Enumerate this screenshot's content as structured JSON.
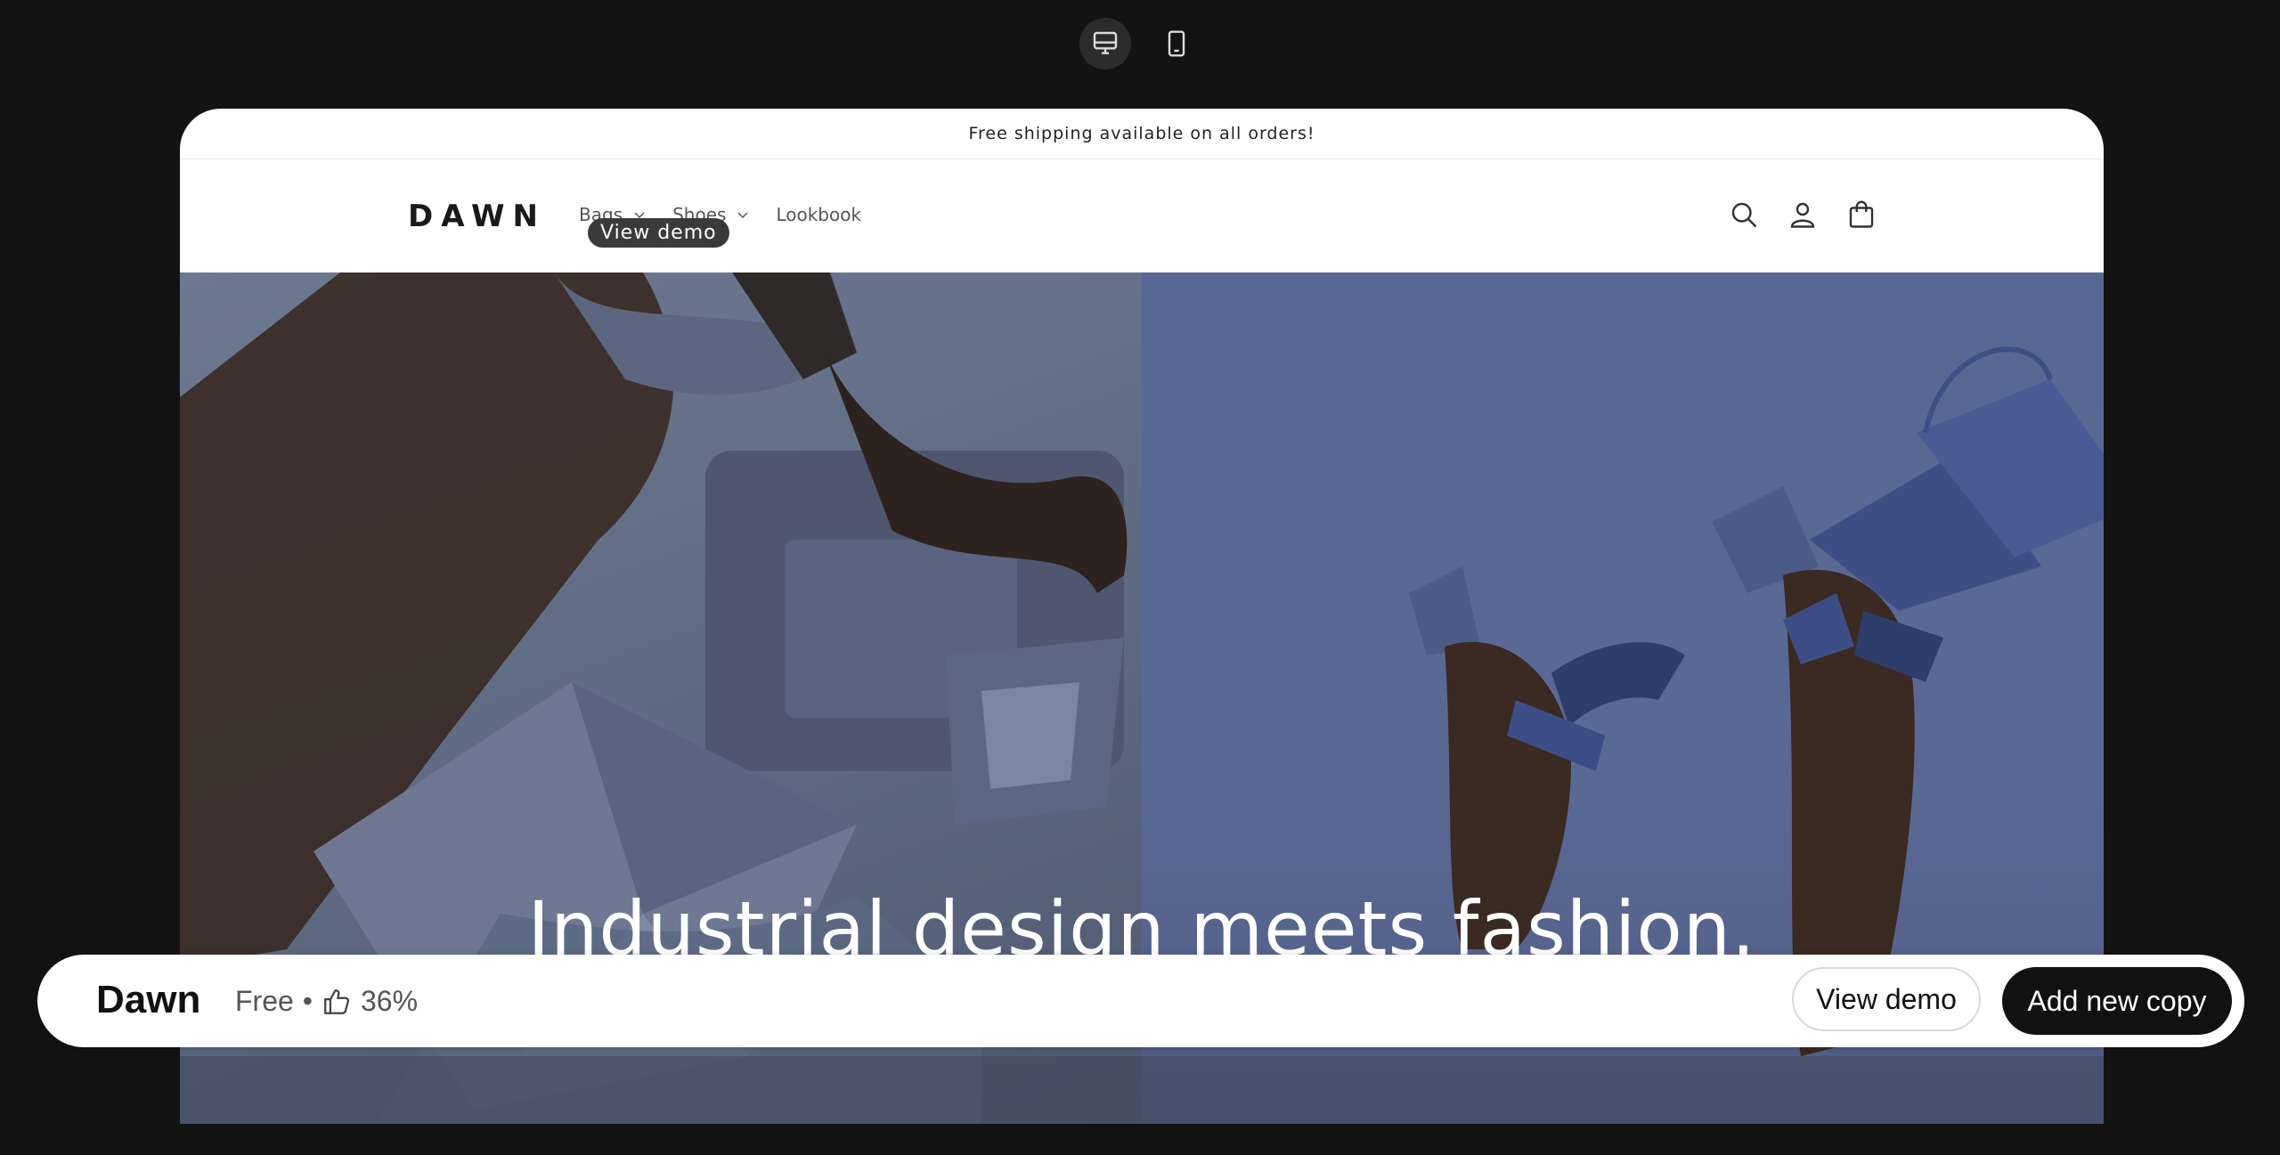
{
  "device_toggle": {
    "desktop_icon": "desktop-icon",
    "mobile_icon": "mobile-icon",
    "active": "desktop"
  },
  "store": {
    "announcement": "Free shipping available on all orders!",
    "logo": "DAWN",
    "nav": [
      {
        "label": "Bags",
        "has_dropdown": true
      },
      {
        "label": "Shoes",
        "has_dropdown": true
      },
      {
        "label": "Lookbook",
        "has_dropdown": false
      }
    ],
    "tooltip": "View demo",
    "icons": [
      "search-icon",
      "account-icon",
      "cart-icon"
    ],
    "hero_heading": "Industrial design meets fashion."
  },
  "theme_bar": {
    "name": "Dawn",
    "price": "Free",
    "separator": "•",
    "rating": "36%",
    "view_demo_label": "View demo",
    "add_copy_label": "Add new copy"
  },
  "colors": {
    "page_bg": "#131313",
    "primary_button": "#111111",
    "hero_left": "#65708a",
    "hero_right": "#596893"
  }
}
